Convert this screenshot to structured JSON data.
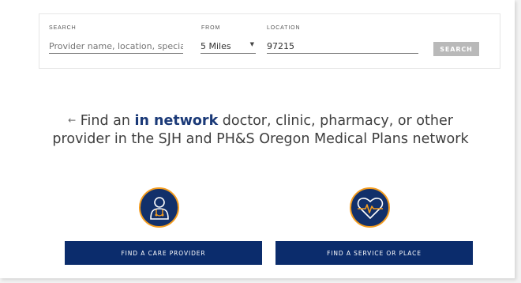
{
  "search": {
    "search_label": "SEARCH",
    "search_placeholder": "Provider name, location, specialty",
    "from_label": "FROM",
    "distance_value": "5 Miles",
    "location_label": "LOCATION",
    "location_value": "97215",
    "search_button": "SEARCH"
  },
  "headline": {
    "arrow": "←",
    "prefix": "Find an ",
    "highlight": "in network",
    "rest": " doctor, clinic, pharmacy, or other",
    "line2": "provider in the SJH and PH&S Oregon Medical Plans network"
  },
  "cards": {
    "provider": {
      "icon": "doctor-icon",
      "button": "FIND A CARE PROVIDER"
    },
    "service": {
      "icon": "heart-pulse-icon",
      "button": "FIND A SERVICE OR PLACE"
    }
  },
  "colors": {
    "navy": "#0b2c6c",
    "icon_bg": "#12306a",
    "accent_orange": "#f39c1f",
    "highlight_text": "#1b3a78",
    "search_button_bg": "#b9b9b9"
  }
}
